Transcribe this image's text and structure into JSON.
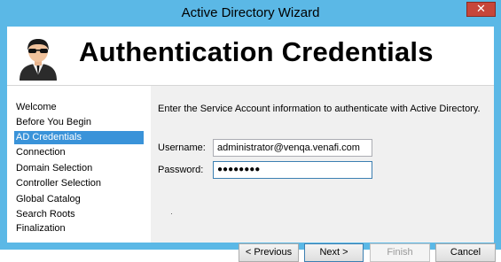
{
  "window": {
    "title": "Active Directory Wizard",
    "close_symbol": "✕"
  },
  "header": {
    "title": "Authentication Credentials",
    "icon": "agent-avatar-icon"
  },
  "sidebar": {
    "items": [
      {
        "label": "Welcome",
        "active": false
      },
      {
        "label": "Before You Begin",
        "active": false
      },
      {
        "label": "AD Credentials",
        "active": true
      },
      {
        "label": "Connection",
        "active": false
      },
      {
        "label": "Domain Selection",
        "active": false
      },
      {
        "label": "Controller Selection",
        "active": false
      },
      {
        "label": "Global Catalog",
        "active": false
      },
      {
        "label": "Search Roots",
        "active": false
      },
      {
        "label": "Finalization",
        "active": false
      }
    ]
  },
  "form": {
    "intro": "Enter the Service Account information to authenticate with Active Directory.",
    "username_label": "Username:",
    "username_value": "administrator@venqa.venafi.com",
    "password_label": "Password:",
    "password_value": "●●●●●●●●"
  },
  "buttons": {
    "previous": "< Previous",
    "next": "Next >",
    "finish": "Finish",
    "cancel": "Cancel"
  },
  "colors": {
    "frame": "#5bb8e6",
    "selection": "#3a93d9",
    "close": "#c7463a"
  }
}
